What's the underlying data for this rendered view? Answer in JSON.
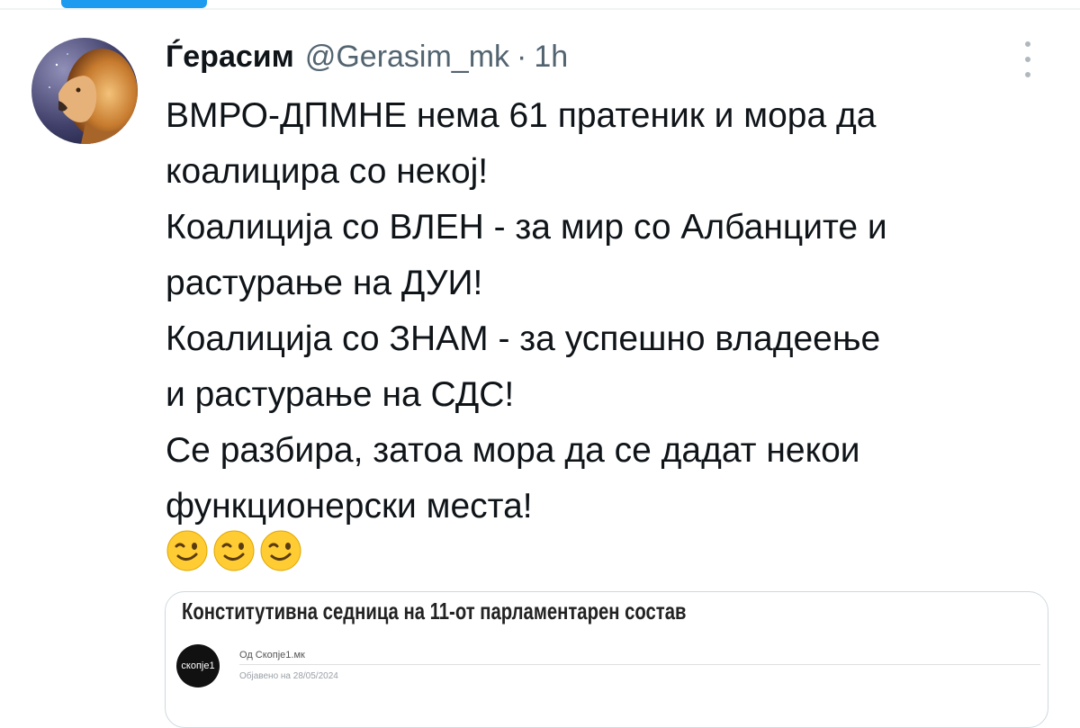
{
  "tweet": {
    "author_name": "Ѓерасим",
    "handle": "@Gerasim_mk",
    "separator": "·",
    "time": "1h",
    "lines": [
      "ВМРО-ДПМНЕ нема 61 пратеник и мора да",
      "коалицира со некој!",
      "Коалиција со ВЛЕН - за мир со Албанците и",
      "растурање на ДУИ!",
      "Коалиција со ЗНАМ - за успешно владеење",
      "и растурање на СДС!",
      "Се разбира, затоа мора да се дадат некои",
      "функционерски места!"
    ],
    "emojis": [
      "winking-face",
      "winking-face",
      "winking-face"
    ]
  },
  "link_card": {
    "title": "Конститутивна седница на 11-от парламентарен состав",
    "logo_text": "скопје1",
    "source": "Од Скопје1.мк",
    "date": "Објавено на 28/05/2024"
  },
  "colors": {
    "accent": "#1d9bf0",
    "text": "#0f1419",
    "secondary": "#536471"
  }
}
